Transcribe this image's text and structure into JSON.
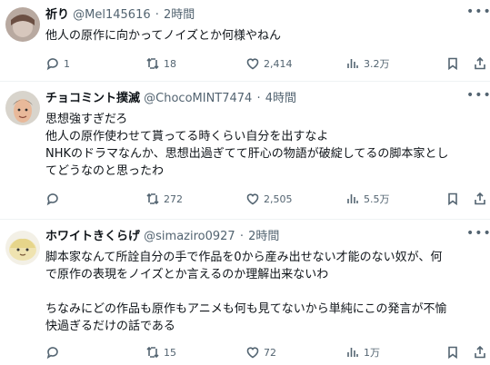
{
  "tweets": [
    {
      "name": "祈り",
      "handle": "@Mel145616",
      "time": "2時間",
      "text": "他人の原作に向かってノイズとか何様やねん",
      "replies": "1",
      "retweets": "18",
      "likes": "2,414",
      "views": "3.2万"
    },
    {
      "name": "チョコミント撲滅",
      "handle": "@ChocoMINT7474",
      "time": "4時間",
      "text": "思想強すぎだろ\n他人の原作使わせて貰ってる時くらい自分を出すなよ\nNHKのドラマなんか、思想出過ぎてて肝心の物語が破綻してるの脚本家とし\nてどうなのと思ったわ",
      "replies": "",
      "retweets": "272",
      "likes": "2,505",
      "views": "5.5万"
    },
    {
      "name": "ホワイトきくらげ",
      "handle": "@simaziro0927",
      "time": "2時間",
      "text": "脚本家なんて所詮自分の手で作品を0から産み出せない才能のない奴が、何\nで原作の表現をノイズとか言えるのか理解出来ないわ\n\nちなみにどの作品も原作もアニメも何も見てないから単純にこの発言が不愉\n快過ぎるだけの話である",
      "replies": "",
      "retweets": "15",
      "likes": "72",
      "views": "1万"
    }
  ],
  "separator": "·",
  "icons": [
    "reply-icon",
    "retweet-icon",
    "like-icon",
    "views-icon",
    "bookmark-icon",
    "share-icon",
    "more-icon"
  ],
  "colors": {
    "text": "#0f1419",
    "secondary": "#536471",
    "border": "#eff3f4"
  }
}
